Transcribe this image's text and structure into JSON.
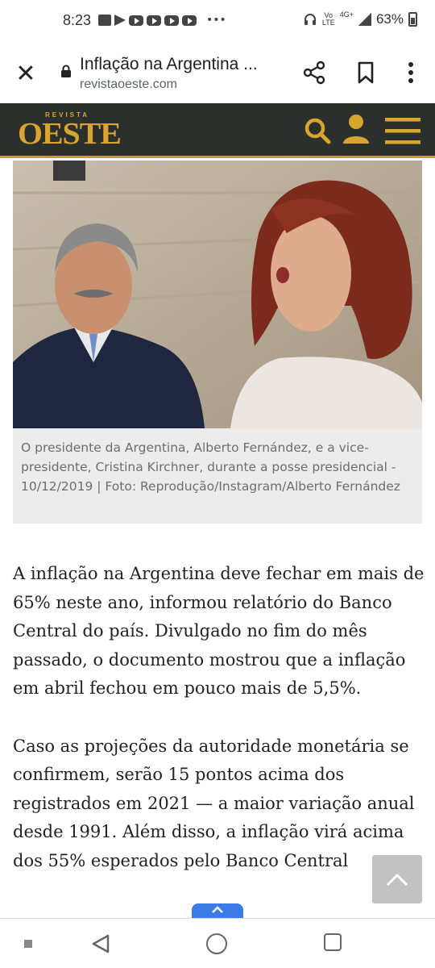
{
  "status_bar": {
    "time": "8:23",
    "battery": "63%",
    "network": "4G+",
    "dots": "•••"
  },
  "browser": {
    "title": "Inflação na Argentina ...",
    "url": "revistaoeste.com",
    "close_symbol": "✕"
  },
  "site": {
    "logo_top": "REVISTA",
    "logo_main": "OESTE",
    "brand_color": "#d9a531",
    "header_bg": "#2c302d"
  },
  "hero": {
    "caption": "O presidente da Argentina, Alberto Fernández, e a vice-presidente, Cristina Kirchner, durante a posse presidencial - 10/12/2019 | Foto: Reprodução/Instagram/Alberto Fernández"
  },
  "article": {
    "paragraphs": [
      "A inflação na Argentina deve fechar em mais de 65% neste ano, informou relatório do Banco Central do país. Divulgado no fim do mês passado, o documento mostrou que a inflação em abril fechou em pouco mais de 5,5%.",
      "Caso as projeções da autoridade monetária se confirmem, serão 15 pontos acima dos registrados em 2021 — a maior variação anual desde 1991. Além disso, a inflação virá acima dos 55% esperados pelo Banco Central"
    ]
  }
}
